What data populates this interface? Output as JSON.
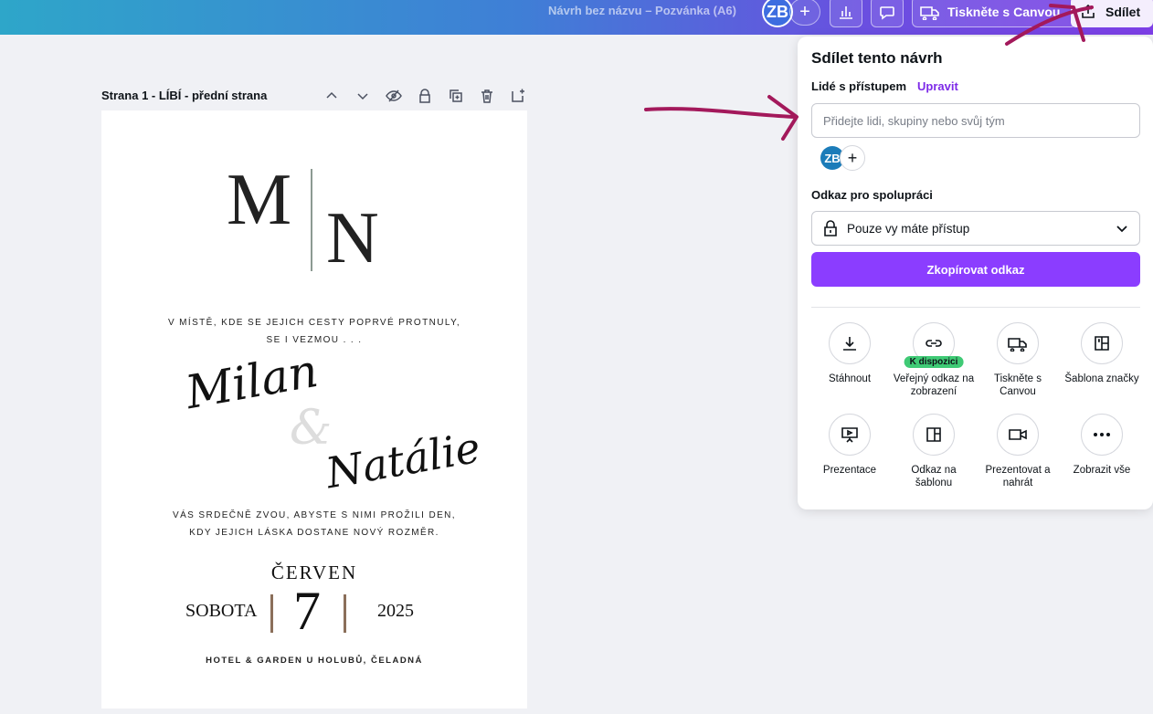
{
  "topbar": {
    "doc_title": "Návrh bez názvu – Pozvánka (A6)",
    "avatar_initials": "ZB",
    "add_symbol": "+",
    "print_label": "Tiskněte s Canvou",
    "share_label": "Sdílet"
  },
  "page": {
    "label": "Strana 1 - LÍBÍ - přední strana"
  },
  "invitation": {
    "mono_left": "M",
    "mono_right": "N",
    "line1": "V MÍSTĚ, KDE SE JEJICH CESTY POPRVÉ PROTNULY,",
    "line2": "SE I VEZMOU . . .",
    "name1": "Milan",
    "amp": "&",
    "name2": "Natálie",
    "line3": "VÁS SRDEČNĚ ZVOU, ABYSTE S NIMI PROŽILI DEN,",
    "line4": "KDY JEJICH LÁSKA DOSTANE NOVÝ ROZMĚR.",
    "month": "ČERVEN",
    "day_name": "SOBOTA",
    "day_number": "7",
    "year": "2025",
    "venue": "HOTEL & GARDEN U HOLUBŮ, ČELADNÁ"
  },
  "share_panel": {
    "title": "Sdílet tento návrh",
    "access_label": "Lidé s přístupem",
    "edit_link": "Upravit",
    "input_placeholder": "Přidejte lidi, skupiny nebo svůj tým",
    "avatar_initials": "ZB",
    "add_symbol": "+",
    "collab_label": "Odkaz pro spolupráci",
    "access_value": "Pouze vy máte přístup",
    "copy_button": "Zkopírovat odkaz",
    "options": [
      {
        "label": "Stáhnout",
        "icon": "download-icon"
      },
      {
        "label": "Veřejný odkaz na zobrazení",
        "icon": "link-icon",
        "badge": "K dispozici"
      },
      {
        "label": "Tiskněte s Canvou",
        "icon": "truck-icon"
      },
      {
        "label": "Šablona značky",
        "icon": "brand-template-icon"
      },
      {
        "label": "Prezentace",
        "icon": "presentation-icon"
      },
      {
        "label": "Odkaz na šablonu",
        "icon": "template-link-icon"
      },
      {
        "label": "Prezentovat a nahrát",
        "icon": "video-camera-icon"
      },
      {
        "label": "Zobrazit vše",
        "icon": "more-icon"
      }
    ]
  },
  "colors": {
    "accent_purple": "#8b3dff",
    "edit_purple": "#7d2ae8",
    "annotation": "#a3195b",
    "badge_green": "#3fca75"
  }
}
